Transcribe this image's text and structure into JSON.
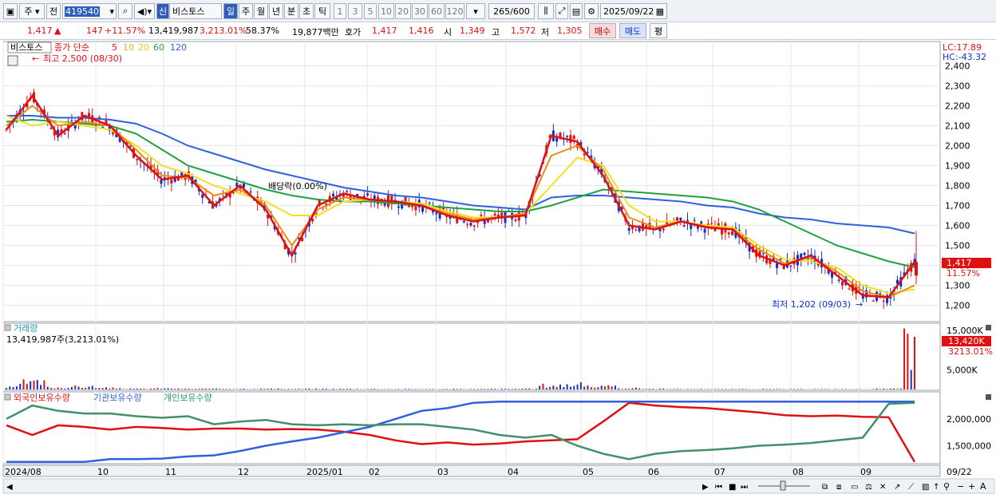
{
  "toolbar": {
    "market": "주",
    "prev": "전",
    "code": "419540",
    "new_badge": "신",
    "name": "비스토스",
    "periods": [
      "일",
      "주",
      "월",
      "년",
      "분",
      "초",
      "틱"
    ],
    "numbers": [
      "1",
      "3",
      "5",
      "10",
      "20",
      "30",
      "60",
      "120"
    ],
    "count": "265",
    "count_total": "/600",
    "date": "2025/09/22"
  },
  "quote": {
    "price": "1,417",
    "arrow": "▲",
    "change": "147",
    "change_pct": "+11.57%",
    "volume": "13,419,987",
    "volume_pct": "3,213.01%",
    "turnover_pct": "58.37%",
    "amount": "19,877백만",
    "hoga_label": "호가",
    "ask": "1,417",
    "bid": "1,416",
    "open_label": "시",
    "open": "1,349",
    "high_label": "고",
    "high": "1,572",
    "low_label": "저",
    "low": "1,305",
    "buy": "매수",
    "sell": "매도",
    "avg": "평"
  },
  "main_legend": {
    "stock": "비스토스",
    "ma_label": "종가 단순",
    "ma5": "5",
    "ma10": "10",
    "ma20": "20",
    "ma60": "60",
    "ma120": "120",
    "high_note": "최고 2,500 (08/30)",
    "low_note": "최저 1,202 (09/03)",
    "dividend_note": "배당락(0.00%)",
    "lc": "LC:17.89",
    "hc": "HC:-43.32",
    "price_tag": "1,417",
    "pct_tag": "11.57%"
  },
  "volume_panel": {
    "title": "거래량",
    "info": "13,419,987주(3,213.01%)",
    "tag": "13,420K",
    "tag_pct": "3213.01%"
  },
  "holder_panel": {
    "foreign": "외국인보유수량",
    "inst": "기관보유수량",
    "indiv": "개인보유수량"
  },
  "colors": {
    "up": "#e01010",
    "down": "#1030d0",
    "ma5": "#e01010",
    "ma10": "#f08a10",
    "ma20": "#f0e020",
    "ma60": "#20a040",
    "ma120": "#3060e0"
  },
  "chart_data": [
    {
      "type": "candlestick",
      "title": "비스토스",
      "x": [
        "2024/08",
        "10",
        "11",
        "12",
        "2025/01",
        "02",
        "03",
        "04",
        "05",
        "06",
        "07",
        "08",
        "09",
        "09/22"
      ],
      "ylim": [
        1150,
        2500
      ],
      "y_ticks": [
        1200,
        1300,
        1400,
        1500,
        1600,
        1700,
        1800,
        1900,
        2000,
        2100,
        2200,
        2300,
        2400
      ],
      "series": [
        {
          "name": "5",
          "values": [
            2080,
            2250,
            2050,
            2150,
            2100,
            1950,
            1830,
            1850,
            1700,
            1800,
            1680,
            1450,
            1700,
            1760,
            1730,
            1720,
            1700,
            1650,
            1620,
            1640,
            1650,
            2050,
            2020,
            1850,
            1600,
            1580,
            1620,
            1590,
            1580,
            1450,
            1400,
            1450,
            1350,
            1250,
            1240,
            1417
          ]
        },
        {
          "name": "10",
          "values": [
            2100,
            2200,
            2100,
            2120,
            2100,
            1980,
            1850,
            1840,
            1750,
            1780,
            1700,
            1500,
            1680,
            1740,
            1730,
            1720,
            1700,
            1660,
            1630,
            1640,
            1660,
            1950,
            2000,
            1880,
            1640,
            1590,
            1620,
            1595,
            1580,
            1480,
            1410,
            1440,
            1370,
            1270,
            1240,
            1300
          ]
        },
        {
          "name": "20",
          "values": [
            2150,
            2100,
            2120,
            2100,
            2080,
            2000,
            1900,
            1860,
            1800,
            1760,
            1720,
            1650,
            1650,
            1720,
            1730,
            1720,
            1710,
            1670,
            1640,
            1640,
            1660,
            1800,
            1940,
            1900,
            1700,
            1620,
            1620,
            1600,
            1590,
            1500,
            1430,
            1420,
            1390,
            1300,
            1260,
            1280
          ]
        },
        {
          "name": "60",
          "values": [
            2120,
            2130,
            2120,
            2110,
            2100,
            2060,
            1980,
            1900,
            1860,
            1820,
            1780,
            1750,
            1730,
            1720,
            1720,
            1710,
            1700,
            1690,
            1680,
            1670,
            1670,
            1700,
            1740,
            1780,
            1770,
            1760,
            1750,
            1740,
            1720,
            1680,
            1620,
            1560,
            1500,
            1460,
            1420,
            1390
          ]
        },
        {
          "name": "120",
          "values": [
            2150,
            2150,
            2140,
            2140,
            2130,
            2110,
            2060,
            2000,
            1960,
            1920,
            1880,
            1850,
            1820,
            1790,
            1770,
            1750,
            1740,
            1720,
            1700,
            1690,
            1680,
            1740,
            1750,
            1750,
            1740,
            1730,
            1720,
            1700,
            1690,
            1660,
            1640,
            1630,
            1610,
            1600,
            1590,
            1560
          ]
        }
      ],
      "annotations": [
        "최고 2,500 (08/30)",
        "최저 1,202 (09/03)",
        "배당락(0.00%)"
      ]
    },
    {
      "type": "bar",
      "title": "거래량",
      "y_ticks": [
        "5,000K",
        "15,000K"
      ],
      "values": [
        0.3,
        1.0,
        0.3,
        0.4,
        0.2,
        0.1,
        0.15,
        0.1,
        0.1,
        0.1,
        0.1,
        0.08,
        0.1,
        0.09,
        0.08,
        0.06,
        0.06,
        0.07,
        0.06,
        0.08,
        0.1,
        0.6,
        0.7,
        0.4,
        0.2,
        0.1,
        0.06,
        0.07,
        0.06,
        0.06,
        0.05,
        0.06,
        0.05,
        0.04,
        0.1,
        6.0
      ]
    },
    {
      "type": "line",
      "title": "보유수량",
      "y_ticks": [
        "1,500,000",
        "2,000,000"
      ],
      "series": [
        {
          "name": "외국인보유수량",
          "values": [
            1880,
            1700,
            1880,
            1850,
            1800,
            1850,
            1830,
            1800,
            1820,
            1820,
            1800,
            1810,
            1800,
            1760,
            1700,
            1600,
            1530,
            1560,
            1520,
            1540,
            1580,
            1600,
            1620,
            1950,
            2300,
            2250,
            2220,
            2200,
            2160,
            2120,
            2070,
            2050,
            2060,
            2040,
            2030,
            1200
          ]
        },
        {
          "name": "기관보유수량",
          "values": [
            1200,
            1200,
            1200,
            1200,
            1250,
            1250,
            1260,
            1300,
            1320,
            1400,
            1500,
            1580,
            1650,
            1750,
            1850,
            2000,
            2150,
            2200,
            2300,
            2320,
            2320,
            2320,
            2320,
            2320,
            2320,
            2320,
            2320,
            2320,
            2320,
            2320,
            2320,
            2320,
            2320,
            2320,
            2320,
            2320
          ]
        },
        {
          "name": "개인보유수량",
          "values": [
            2000,
            2250,
            2150,
            2100,
            2100,
            2050,
            2020,
            2050,
            1900,
            1950,
            1980,
            1900,
            1880,
            1900,
            1880,
            1900,
            1900,
            1850,
            1800,
            1700,
            1650,
            1700,
            1500,
            1350,
            1250,
            1350,
            1400,
            1420,
            1450,
            1500,
            1520,
            1550,
            1600,
            1650,
            2280,
            2300
          ]
        }
      ]
    }
  ]
}
